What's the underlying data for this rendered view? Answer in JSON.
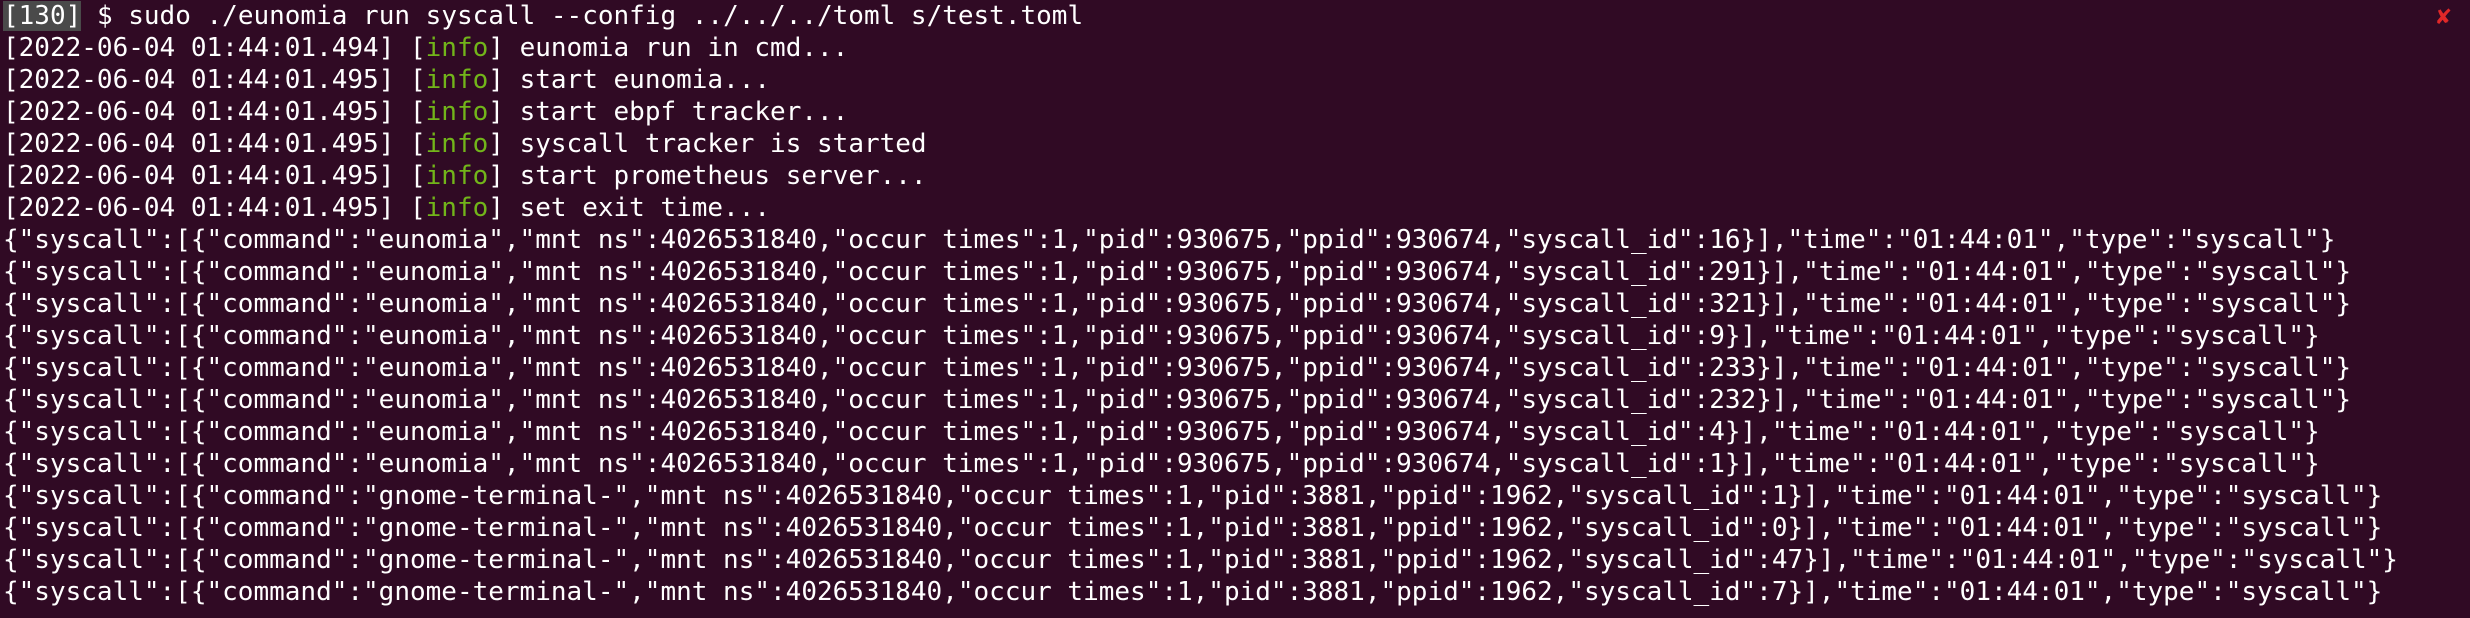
{
  "colors": {
    "background": "#300a24",
    "foreground": "#ffffff",
    "info_level": "#72b51a",
    "exit_indicator": "#e02828"
  },
  "prompt": {
    "exit_code": "130",
    "symbol": "$",
    "command": "sudo ./eunomia run syscall --config ../../../toml s/test.toml",
    "exit_indicator": "✘"
  },
  "logs": [
    {
      "timestamp": "2022-06-04 01:44:01.494",
      "level": "info",
      "message": "eunomia run in cmd..."
    },
    {
      "timestamp": "2022-06-04 01:44:01.495",
      "level": "info",
      "message": "start eunomia..."
    },
    {
      "timestamp": "2022-06-04 01:44:01.495",
      "level": "info",
      "message": "start ebpf tracker..."
    },
    {
      "timestamp": "2022-06-04 01:44:01.495",
      "level": "info",
      "message": "syscall tracker is started"
    },
    {
      "timestamp": "2022-06-04 01:44:01.495",
      "level": "info",
      "message": "start prometheus server..."
    },
    {
      "timestamp": "2022-06-04 01:44:01.495",
      "level": "info",
      "message": "set exit time..."
    }
  ],
  "json_lines": [
    "{\"syscall\":[{\"command\":\"eunomia\",\"mnt ns\":4026531840,\"occur times\":1,\"pid\":930675,\"ppid\":930674,\"syscall_id\":16}],\"time\":\"01:44:01\",\"type\":\"syscall\"}",
    "{\"syscall\":[{\"command\":\"eunomia\",\"mnt ns\":4026531840,\"occur times\":1,\"pid\":930675,\"ppid\":930674,\"syscall_id\":291}],\"time\":\"01:44:01\",\"type\":\"syscall\"}",
    "{\"syscall\":[{\"command\":\"eunomia\",\"mnt ns\":4026531840,\"occur times\":1,\"pid\":930675,\"ppid\":930674,\"syscall_id\":321}],\"time\":\"01:44:01\",\"type\":\"syscall\"}",
    "{\"syscall\":[{\"command\":\"eunomia\",\"mnt ns\":4026531840,\"occur times\":1,\"pid\":930675,\"ppid\":930674,\"syscall_id\":9}],\"time\":\"01:44:01\",\"type\":\"syscall\"}",
    "{\"syscall\":[{\"command\":\"eunomia\",\"mnt ns\":4026531840,\"occur times\":1,\"pid\":930675,\"ppid\":930674,\"syscall_id\":233}],\"time\":\"01:44:01\",\"type\":\"syscall\"}",
    "{\"syscall\":[{\"command\":\"eunomia\",\"mnt ns\":4026531840,\"occur times\":1,\"pid\":930675,\"ppid\":930674,\"syscall_id\":232}],\"time\":\"01:44:01\",\"type\":\"syscall\"}",
    "{\"syscall\":[{\"command\":\"eunomia\",\"mnt ns\":4026531840,\"occur times\":1,\"pid\":930675,\"ppid\":930674,\"syscall_id\":4}],\"time\":\"01:44:01\",\"type\":\"syscall\"}",
    "{\"syscall\":[{\"command\":\"eunomia\",\"mnt ns\":4026531840,\"occur times\":1,\"pid\":930675,\"ppid\":930674,\"syscall_id\":1}],\"time\":\"01:44:01\",\"type\":\"syscall\"}",
    "{\"syscall\":[{\"command\":\"gnome-terminal-\",\"mnt ns\":4026531840,\"occur times\":1,\"pid\":3881,\"ppid\":1962,\"syscall_id\":1}],\"time\":\"01:44:01\",\"type\":\"syscall\"}",
    "{\"syscall\":[{\"command\":\"gnome-terminal-\",\"mnt ns\":4026531840,\"occur times\":1,\"pid\":3881,\"ppid\":1962,\"syscall_id\":0}],\"time\":\"01:44:01\",\"type\":\"syscall\"}",
    "{\"syscall\":[{\"command\":\"gnome-terminal-\",\"mnt ns\":4026531840,\"occur times\":1,\"pid\":3881,\"ppid\":1962,\"syscall_id\":47}],\"time\":\"01:44:01\",\"type\":\"syscall\"}",
    "{\"syscall\":[{\"command\":\"gnome-terminal-\",\"mnt ns\":4026531840,\"occur times\":1,\"pid\":3881,\"ppid\":1962,\"syscall_id\":7}],\"time\":\"01:44:01\",\"type\":\"syscall\"}"
  ]
}
